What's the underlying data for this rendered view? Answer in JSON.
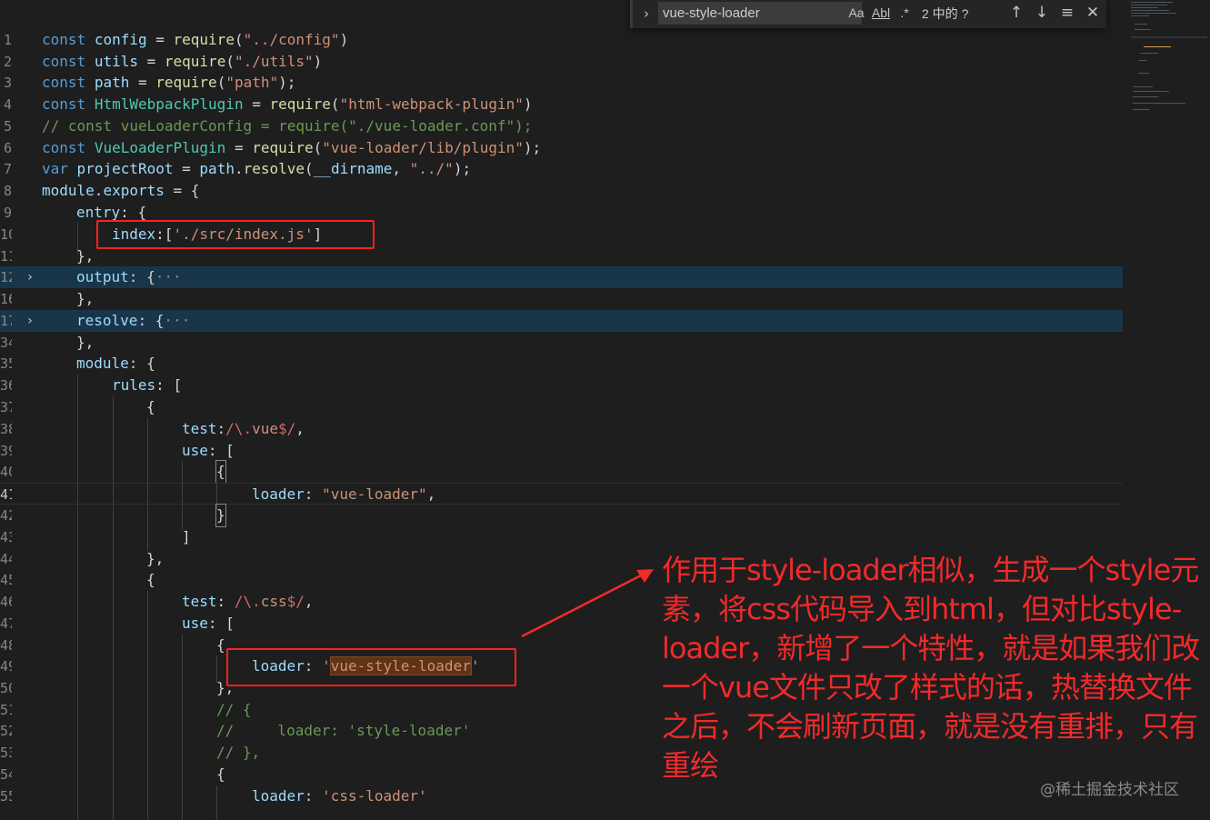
{
  "find_widget": {
    "query": "vue-style-loader",
    "match_case_label": "Aa",
    "whole_word_label": "Abl",
    "regex_label": ".*",
    "result_count": "2 中的 ?",
    "prev_icon": "arrow-up-icon",
    "next_icon": "arrow-down-icon",
    "selection_icon": "find-in-selection-icon",
    "close_icon": "close-icon"
  },
  "gutter": [
    "1",
    "2",
    "3",
    "4",
    "5",
    "6",
    "7",
    "8",
    "9",
    "10",
    "11",
    "12",
    "16",
    "17",
    "34",
    "35",
    "36",
    "37",
    "38",
    "39",
    "40",
    "41",
    "42",
    "43",
    "44",
    "45",
    "46",
    "47",
    "48",
    "49",
    "50",
    "51",
    "52",
    "53",
    "54",
    "55"
  ],
  "code": {
    "l1_kw": "const",
    "l1_var": "config",
    "l1_eq": " = ",
    "l1_fn": "require",
    "l1_p1": "(",
    "l1_str": "\"../config\"",
    "l1_p2": ")",
    "l2_kw": "const",
    "l2_var": "utils",
    "l2_eq": " = ",
    "l2_fn": "require",
    "l2_p1": "(",
    "l2_str": "\"./utils\"",
    "l2_p2": ")",
    "l3_kw": "const",
    "l3_var": "path",
    "l3_eq": " = ",
    "l3_fn": "require",
    "l3_p1": "(",
    "l3_str": "\"path\"",
    "l3_p2": ");",
    "l4_kw": "const",
    "l4_cls": "HtmlWebpackPlugin",
    "l4_eq": " = ",
    "l4_fn": "require",
    "l4_p1": "(",
    "l4_str": "\"html-webpack-plugin\"",
    "l4_p2": ")",
    "l5_cmt": "// const vueLoaderConfig = require(\"./vue-loader.conf\");",
    "l6_kw": "const",
    "l6_cls": "VueLoaderPlugin",
    "l6_eq": " = ",
    "l6_fn": "require",
    "l6_p1": "(",
    "l6_str": "\"vue-loader/lib/plugin\"",
    "l6_p2": ");",
    "l7_kw": "var",
    "l7_var": "projectRoot",
    "l7_eq": " = ",
    "l7_var2": "path",
    "l7_dot": ".",
    "l7_fn": "resolve",
    "l7_p1": "(",
    "l7_var3": "__dirname",
    "l7_comma": ", ",
    "l7_str": "\"../\"",
    "l7_p2": ");",
    "l8_var": "module",
    "l8_dot": ".",
    "l8_var2": "exports",
    "l8_rest": " = {",
    "l9_key": "entry",
    "l9_rest": ": {",
    "l10_key": "index",
    "l10_p1": ":[",
    "l10_str": "'./src/index.js'",
    "l10_p2": "]",
    "l11": "},",
    "l12_key": "output",
    "l12_rest": ": {",
    "l12_ell": "···",
    "l16": "},",
    "l17_key": "resolve",
    "l17_rest": ": {",
    "l17_ell": "···",
    "l34": "},",
    "l35_key": "module",
    "l35_rest": ": {",
    "l36_key": "rules",
    "l36_rest": ": [",
    "l37": "{",
    "l38_key": "test",
    "l38_p1": ":",
    "l38_rx1": "/\\.",
    "l38_rx2": "vue",
    "l38_rx3": "$/",
    "l38_p2": ",",
    "l39_key": "use",
    "l39_rest": ": [",
    "l40": "{",
    "l41_key": "loader",
    "l41_p1": ": ",
    "l41_str": "\"vue-loader\"",
    "l41_p2": ",",
    "l42": "}",
    "l43": "]",
    "l44": "},",
    "l45": "{",
    "l46_key": "test",
    "l46_p1": ": ",
    "l46_rx1": "/\\.",
    "l46_rx2": "css",
    "l46_rx3": "$/",
    "l46_p2": ",",
    "l47_key": "use",
    "l47_rest": ": [",
    "l48": "{",
    "l49_key": "loader",
    "l49_p1": ": ",
    "l49_q1": "'",
    "l49_match": "vue-style-loader",
    "l49_q2": "'",
    "l50": "},",
    "l51_cmt": "// {",
    "l52_cmt": "//     loader: 'style-loader'",
    "l53_cmt": "// },",
    "l54": "{",
    "l55_key": "loader",
    "l55_p1": ": ",
    "l55_str": "'css-loader'"
  },
  "annotation": {
    "text": "作用于style-loader相似，生成一个style元素，将css代码导入到html，但对比style-loader，新增了一个特性，就是如果我们改一个vue文件只改了样式的话，热替换文件之后，不会刷新页面，就是没有重排，只有重绘",
    "color": "#f22a2a"
  },
  "watermark": "@稀土掘金技术社区",
  "theme": {
    "background": "#1e1e1e",
    "keyword": "#569cd6",
    "variable": "#9cdcfe",
    "function": "#dcdcaa",
    "string": "#ce9178",
    "class": "#4ec9b0",
    "comment": "#6a9955",
    "regex": "#d16969",
    "folded_line_bg": "#193549",
    "find_match_bg": "#613214"
  }
}
